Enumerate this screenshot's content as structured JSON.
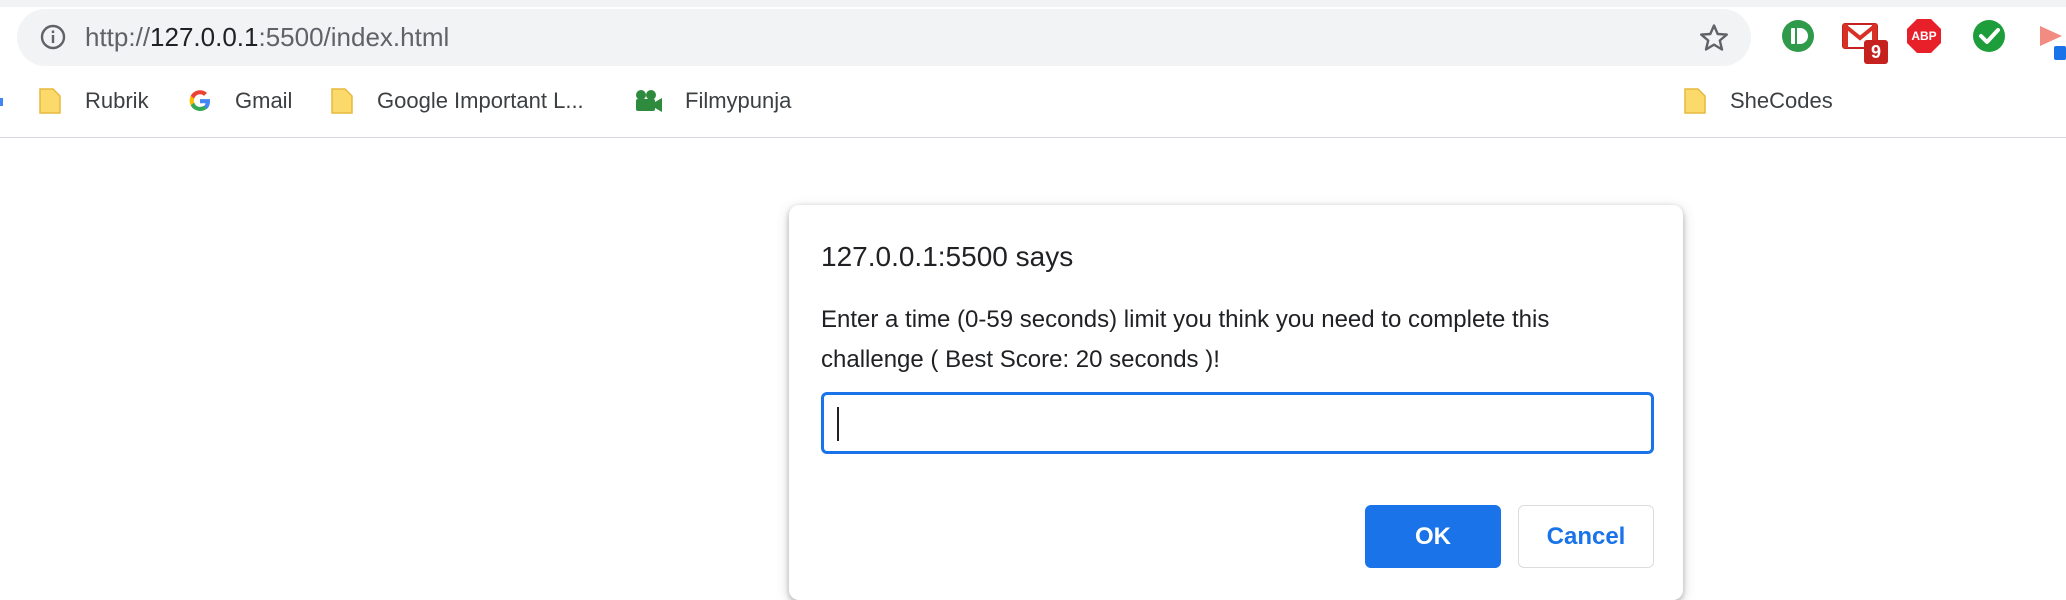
{
  "browser": {
    "url_scheme": "http://",
    "url_host": "127.0.0.1",
    "url_rest": ":5500/index.html",
    "extensions": [
      {
        "name": "pushbullet",
        "badge": ""
      },
      {
        "name": "gmail",
        "badge": "9"
      },
      {
        "name": "adblock-plus",
        "badge": "ABP"
      },
      {
        "name": "check",
        "badge": ""
      }
    ]
  },
  "bookmarks": [
    {
      "label": "Rubrik",
      "icon": "folder-icon"
    },
    {
      "label": "Gmail",
      "icon": "google-icon"
    },
    {
      "label": "Google Important L...",
      "icon": "folder-icon"
    },
    {
      "label": "Filmypunja",
      "icon": "camera-icon"
    },
    {
      "label": "SheCodes",
      "icon": "folder-icon"
    }
  ],
  "dialog": {
    "title": "127.0.0.1:5500 says",
    "message": "Enter a time (0-59 seconds) limit you think you need to complete this challenge ( Best Score: 20 seconds )!",
    "input_value": "",
    "ok_label": "OK",
    "cancel_label": "Cancel"
  },
  "colors": {
    "accent": "#1a73e8",
    "omnibox_bg": "#f1f3f4",
    "folder": "#fbd96b"
  }
}
